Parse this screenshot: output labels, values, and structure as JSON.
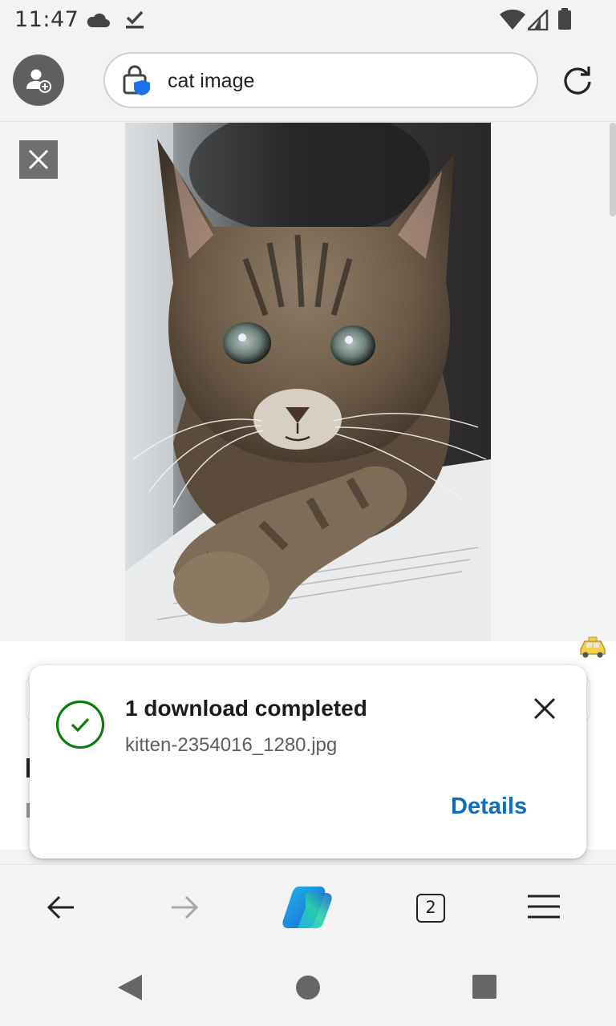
{
  "status_bar": {
    "time": "11:47",
    "icons": [
      "cloud-icon",
      "download-done-icon",
      "wifi-icon",
      "signal-icon",
      "battery-icon"
    ]
  },
  "top_bar": {
    "profile_icon": "add-profile-icon",
    "address": {
      "lock_icon": "shield-lock-icon",
      "query": "cat image"
    },
    "reload_icon": "reload-icon"
  },
  "content": {
    "close_icon": "close-icon",
    "image_alt": "kitten photo"
  },
  "download_toast": {
    "status_icon": "check-circle-icon",
    "title": "1 download completed",
    "filename": "kitten-2354016_1280.jpg",
    "close_icon": "close-icon",
    "action_label": "Details",
    "colors": {
      "check": "#107c10",
      "action": "#0f6cbd"
    }
  },
  "bottom_nav": {
    "back_icon": "arrow-left-icon",
    "forward_icon": "arrow-right-icon",
    "copilot_icon": "copilot-icon",
    "tab_count": "2",
    "menu_icon": "menu-icon"
  },
  "system_nav": [
    "back-triangle-icon",
    "home-circle-icon",
    "recents-square-icon"
  ]
}
